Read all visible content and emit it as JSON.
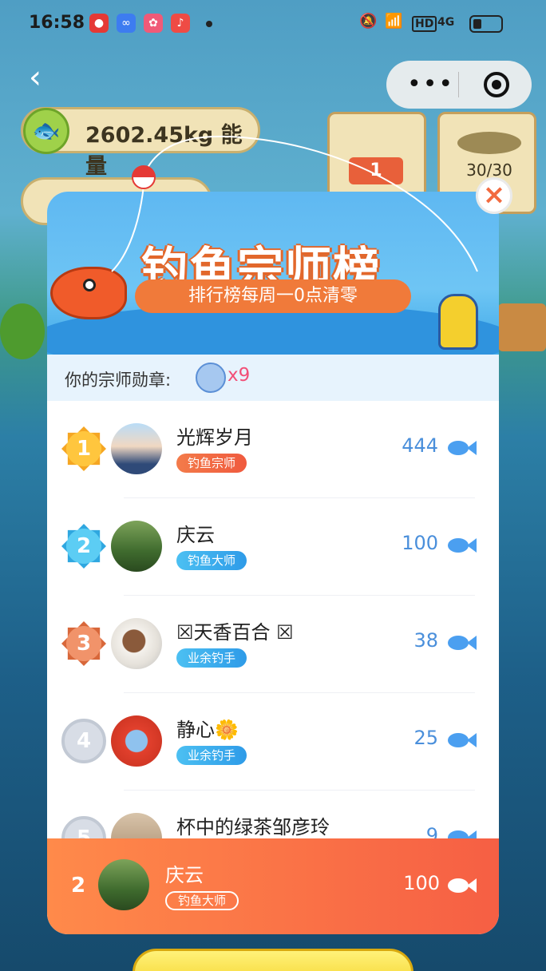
{
  "status_bar": {
    "time": "16:58",
    "network_label": "HD",
    "signal_label": "4G"
  },
  "header": {
    "energy_text": "2602.45kg 能量",
    "board_items": [
      {
        "label": "1"
      },
      {
        "label": "30/30"
      }
    ]
  },
  "modal": {
    "title": "钓鱼宗师榜",
    "subtitle": "排行榜每周一0点清零",
    "medal_label": "你的宗师勋章:",
    "medal_count": "x9",
    "rows": [
      {
        "rank": "1",
        "name": "光辉岁月",
        "tag": "钓鱼宗师",
        "score": "444"
      },
      {
        "rank": "2",
        "name": "庆云",
        "tag": "钓鱼大师",
        "score": "100"
      },
      {
        "rank": "3",
        "name": "☒天香百合 ☒",
        "tag": "业余钓手",
        "score": "38"
      },
      {
        "rank": "4",
        "name": "静心🌼",
        "tag": "业余钓手",
        "score": "25"
      },
      {
        "rank": "5",
        "name": "杯中的绿茶邹彦玲",
        "tag": "",
        "score": "9"
      }
    ],
    "mine": {
      "rank": "2",
      "name": "庆云",
      "tag": "钓鱼大师",
      "score": "100"
    }
  },
  "icons": {
    "back": "chevron-left-icon",
    "more": "more-dots-icon",
    "target": "target-icon",
    "close": "close-icon",
    "fish": "fish-icon"
  },
  "colors": {
    "accent_orange": "#f26a3f",
    "score_blue": "#4a8fdb",
    "medal_pink": "#f24f77"
  }
}
